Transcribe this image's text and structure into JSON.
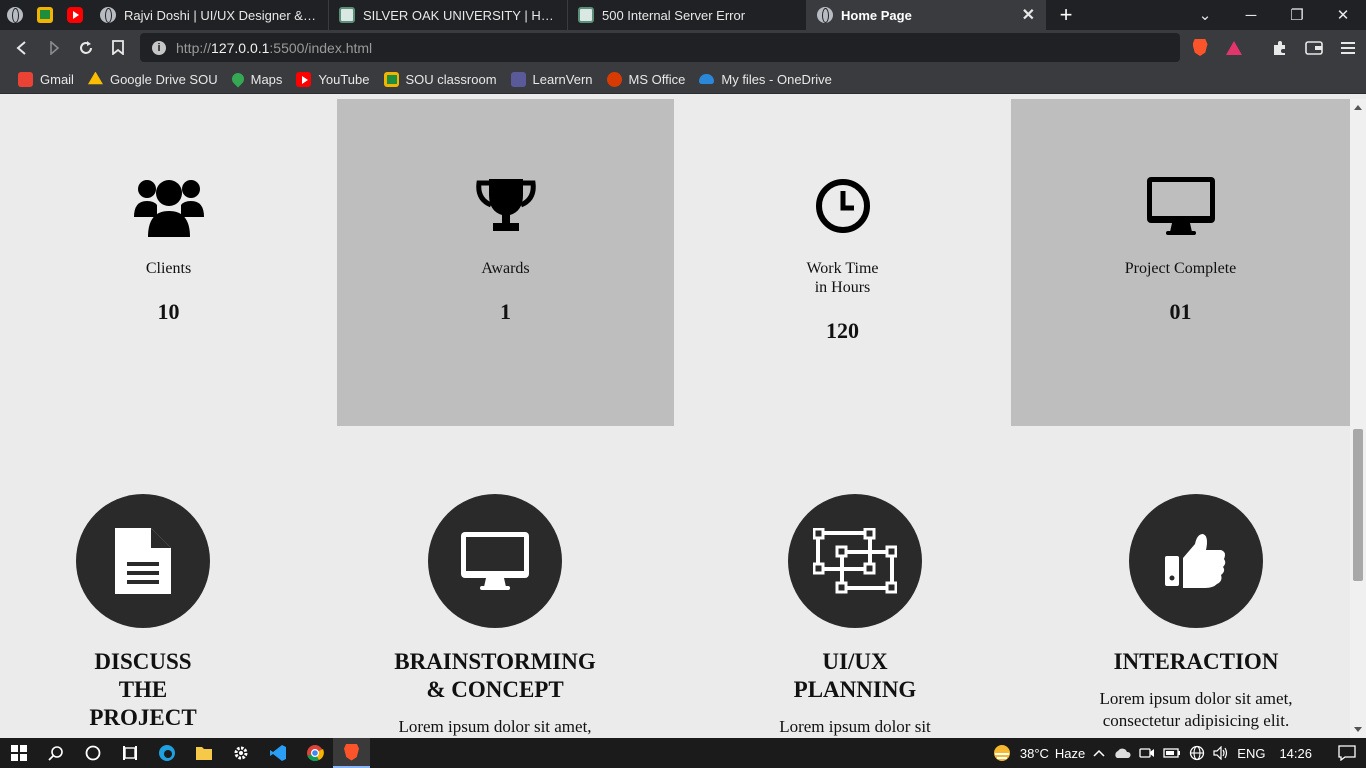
{
  "browser": {
    "tabs": [
      {
        "label": "Rajvi Doshi | UI/UX Designer & React D",
        "icon": "globe-icon",
        "active": false
      },
      {
        "label": "SILVER OAK UNIVERSITY | Home",
        "icon": "sou-favicon",
        "active": false
      },
      {
        "label": "500 Internal Server Error",
        "icon": "sou-favicon",
        "active": false
      },
      {
        "label": "Home Page",
        "icon": "globe-icon",
        "active": true
      }
    ],
    "new_tab": "+",
    "url": {
      "scheme": "http://",
      "host": "127.0.0.1",
      "rest": ":5500/index.html"
    },
    "bookmarks": [
      {
        "label": "Gmail",
        "color": "#ea4335"
      },
      {
        "label": "Google Drive SOU",
        "color": "#fbbc04"
      },
      {
        "label": "Maps",
        "color": "#34a853"
      },
      {
        "label": "YouTube",
        "color": "#ff0000"
      },
      {
        "label": "SOU classroom",
        "color": "#f3b400"
      },
      {
        "label": "LearnVern",
        "color": "#5a5a9a"
      },
      {
        "label": "MS Office",
        "color": "#d83b01"
      },
      {
        "label": "My files - OneDrive",
        "color": "#2b88d8"
      }
    ]
  },
  "stats": [
    {
      "icon": "users-icon",
      "label_line1": "Clients",
      "label_line2": "",
      "value": "10",
      "shaded": false
    },
    {
      "icon": "trophy-icon",
      "label_line1": "Awards",
      "label_line2": "",
      "value": "1",
      "shaded": true
    },
    {
      "icon": "clock-icon",
      "label_line1": "Work Time",
      "label_line2": "in Hours",
      "value": "120",
      "shaded": false
    },
    {
      "icon": "desktop-icon",
      "label_line1": "Project Complete",
      "label_line2": "",
      "value": "01",
      "shaded": true
    }
  ],
  "process": [
    {
      "icon": "document-icon",
      "title_lines": [
        "DISCUSS",
        "THE",
        "PROJECT"
      ],
      "text_lines": []
    },
    {
      "icon": "monitor-icon",
      "title_lines": [
        "BRAINSTORMING",
        "& CONCEPT"
      ],
      "text_lines": [
        "Lorem ipsum dolor sit amet,"
      ]
    },
    {
      "icon": "vector-select-icon",
      "title_lines": [
        "UI/UX",
        "PLANNING"
      ],
      "text_lines": [
        "Lorem ipsum dolor sit"
      ]
    },
    {
      "icon": "thumbs-up-icon",
      "title_lines": [
        "INTERACTION"
      ],
      "text_lines": [
        "Lorem ipsum dolor sit amet,",
        "consectetur adipisicing elit."
      ]
    }
  ],
  "taskbar": {
    "weather_temp": "38°C",
    "weather_text": "Haze",
    "language": "ENG",
    "time": "14:26"
  },
  "colors": {
    "page_bg": "#ebebeb",
    "shaded_bg": "#bebebe",
    "circle_bg": "#2b2a2a"
  }
}
